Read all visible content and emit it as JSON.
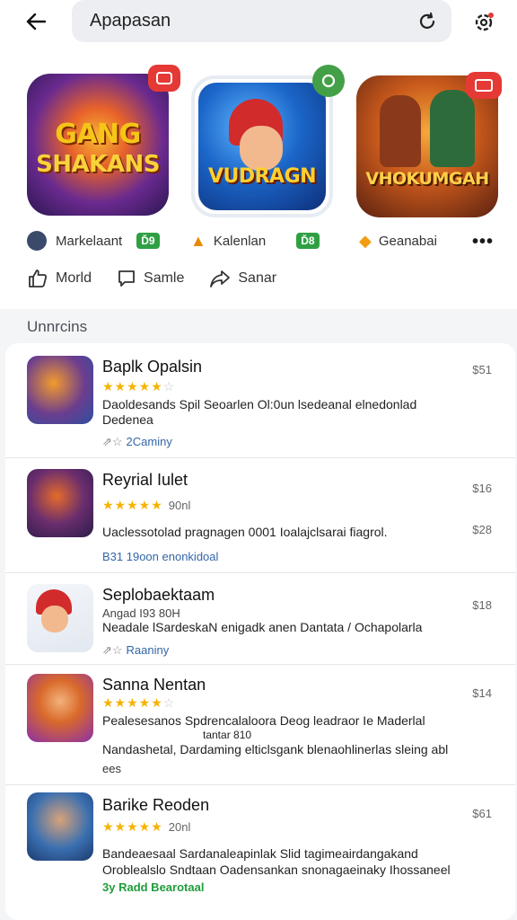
{
  "search": {
    "query": "Apapasan"
  },
  "featured": [
    {
      "title_line1": "GANG",
      "title_line2": "SHAKANS"
    },
    {
      "title_line1": "VUDRAGN"
    },
    {
      "title_line1": "VHOKUMGAH"
    }
  ],
  "developers": [
    {
      "name": "Markelaant",
      "chip": "Ď9"
    },
    {
      "name": "Kalenlan",
      "chip": "Ď8"
    },
    {
      "name": "Geanabai"
    }
  ],
  "actions": {
    "like": "Morld",
    "share": "Samle",
    "send": "Sanar"
  },
  "section": {
    "title": "Unnrcins"
  },
  "items": [
    {
      "title": "Baplk Opalsin",
      "rating_note": "",
      "desc": "Daoldesands Spil Seoarlen Ol:0un lsedeanal elnedonlad Dedenea",
      "meta": "2Caminy",
      "price": "$51",
      "price2": ""
    },
    {
      "title": "Reyrial Iulet",
      "rating_note": "90nl",
      "desc": "Uaclessotolad pragnagen 0001 Ioalajclsarai fiagrol.",
      "meta": "B31 19oon enonkidoal",
      "price": "$16",
      "price2": "$28"
    },
    {
      "title": "Seplobaektaam",
      "rating_note": "",
      "sub": "Angad I93 80H",
      "desc": "Neadale lSardeskaN enigadk anen Dantata / Ochapolarla",
      "meta": "Raaniny",
      "price": "$18",
      "price2": ""
    },
    {
      "title": "Sanna Nentan",
      "rating_note": "",
      "desc": "Pealesesanos Spdrencalaloora Deog leadraor Ie Maderlal",
      "desc_mid": "tantar 810",
      "desc2": "Nandashetal, Dardaming elticlsgank blenaohlinerlas sleing abl",
      "meta": "ees",
      "price": "$14",
      "price2": ""
    },
    {
      "title": "Barike Reoden",
      "rating_note": "20nl",
      "desc": "Bandeaesaal Sardanaleapinlak Slid tagimeairdangakand",
      "desc2": "Oroblealslo Sndtaan Oadensankan snonagaeinaky Ihossaneel",
      "meta": "3y Radd Bearotaal",
      "price": "$61",
      "price2": ""
    }
  ],
  "colors": {
    "accent_red": "#e53935",
    "accent_green": "#43a047",
    "star": "#f5b301"
  }
}
